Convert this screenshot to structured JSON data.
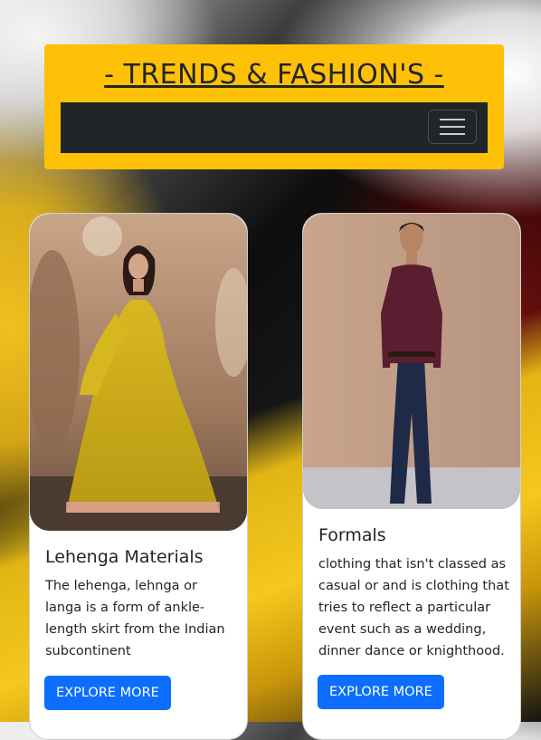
{
  "header": {
    "brand": "- TRENDS & FASHION'S -",
    "background_color": "#ffc107",
    "navbar_color": "#212529",
    "toggler_icon": "hamburger-menu-icon"
  },
  "cards": [
    {
      "image_label": "woman in yellow lehenga",
      "title": "Lehenga Materials",
      "text": "The lehenga, lehnga or langa is a form of ankle-length skirt from the Indian subcontinent",
      "button": "EXPLORE MORE"
    },
    {
      "image_label": "man in formal shirt and trousers",
      "title": "Formals",
      "text": "clothing that isn't classed as casual or and is clothing that tries to reflect a particular event such as a wedding, dinner dance or knighthood.",
      "button": "EXPLORE MORE"
    }
  ],
  "colors": {
    "button": "#0d6efd",
    "accent_yellow": "#ffc107"
  }
}
